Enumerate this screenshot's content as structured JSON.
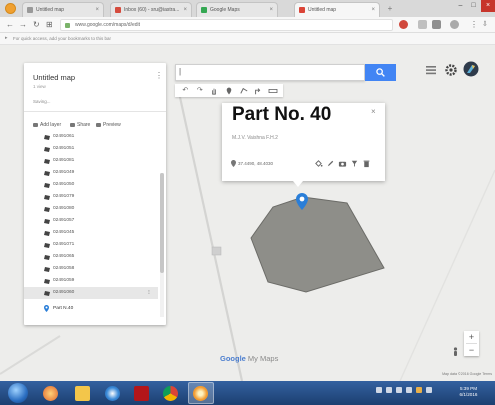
{
  "browser": {
    "tabs": [
      {
        "label": "Untitled map"
      },
      {
        "label": "Inbox (60) - sru@iastra..."
      },
      {
        "label": "Google Maps"
      },
      {
        "label": "Untitled map"
      }
    ],
    "tab_close": "×",
    "new_tab": "+",
    "url": "www.google.com/maps/d/edit",
    "bookmarks_hint": "For quick access, add your bookmarks to this bar",
    "window": {
      "minimize": "–",
      "maximize": "□",
      "close": "×"
    }
  },
  "panel": {
    "title": "Untitled map",
    "views": "1 view",
    "status": "Saving...",
    "more": "⋮",
    "actions": {
      "add_layer": "Add layer",
      "share": "Share",
      "preview": "Preview"
    },
    "items": [
      "02491061",
      "02491051",
      "02491081",
      "02491049",
      "02491050",
      "02491079",
      "02491080",
      "02491057",
      "02491045",
      "02491071",
      "02491065",
      "02491058",
      "02491059",
      "02491060"
    ],
    "selected_index": 13,
    "pin_item": "Part N.40"
  },
  "search": {
    "placeholder": "",
    "cursor": "|"
  },
  "toolbar": [
    "↶",
    "↷"
  ],
  "popup": {
    "title": "Part No. 40",
    "close": "×",
    "subtitle": "M.J.V. Vaishna F.H.2",
    "coords": "37.4490, 48.4030"
  },
  "logo": {
    "brand": "Google",
    "product": " My Maps"
  },
  "zoom": {
    "in": "+",
    "out": "−"
  },
  "attribution": "Map data ©2016 Google   Terms",
  "taskbar": {
    "time": "5:39 PM",
    "date": "6/1/2016"
  },
  "colors": {
    "accent": "#4285f4",
    "polygon_fill": "#8e8e89",
    "pin": "#2a7ed8"
  }
}
